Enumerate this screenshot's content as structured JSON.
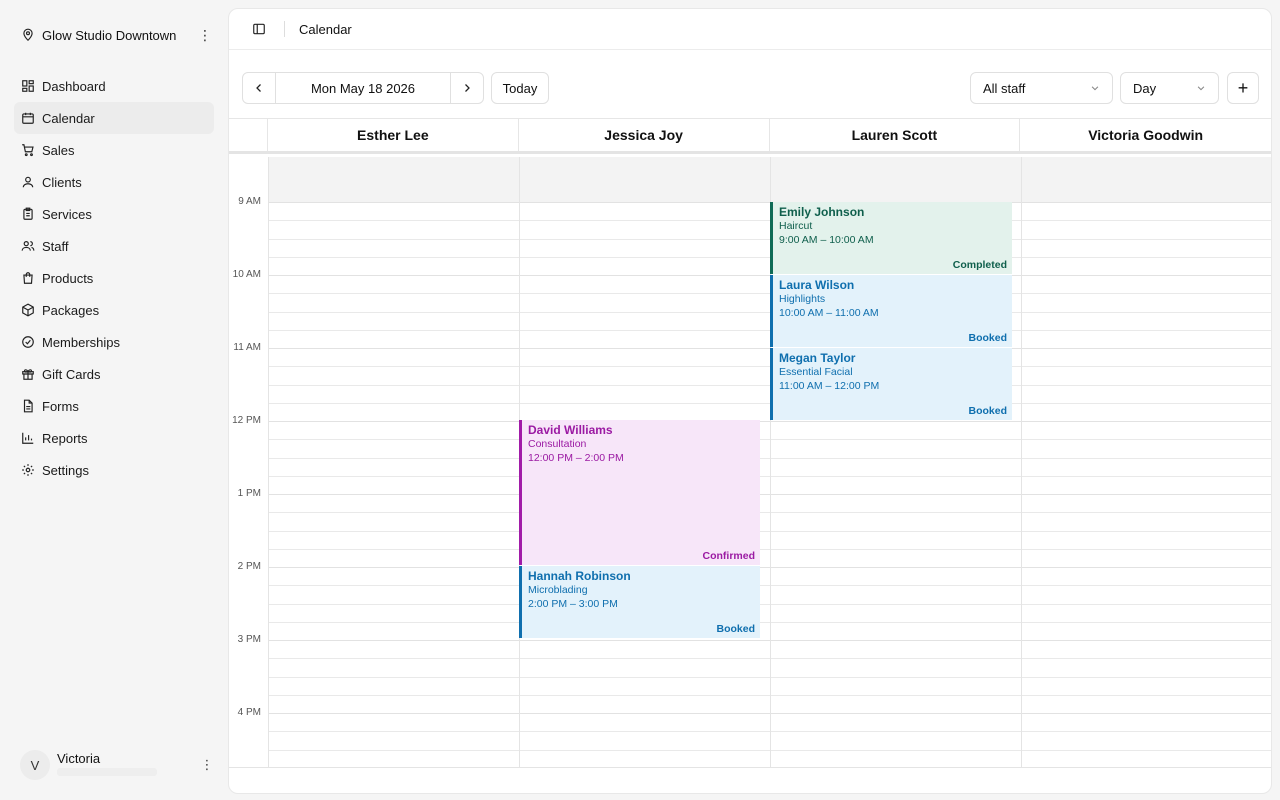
{
  "sidebar": {
    "studio_name": "Glow Studio Downtown",
    "items": [
      {
        "label": "Dashboard",
        "icon": "dashboard-icon"
      },
      {
        "label": "Calendar",
        "icon": "calendar-icon",
        "active": true
      },
      {
        "label": "Sales",
        "icon": "cart-icon"
      },
      {
        "label": "Clients",
        "icon": "user-icon"
      },
      {
        "label": "Services",
        "icon": "clipboard-icon"
      },
      {
        "label": "Staff",
        "icon": "users-icon"
      },
      {
        "label": "Products",
        "icon": "shopping-bag-icon"
      },
      {
        "label": "Packages",
        "icon": "package-icon"
      },
      {
        "label": "Memberships",
        "icon": "badge-check-icon"
      },
      {
        "label": "Gift Cards",
        "icon": "gift-icon"
      },
      {
        "label": "Forms",
        "icon": "document-icon"
      },
      {
        "label": "Reports",
        "icon": "bar-chart-icon"
      },
      {
        "label": "Settings",
        "icon": "gear-icon"
      }
    ],
    "user": {
      "initial": "V",
      "name": "Victoria"
    }
  },
  "header": {
    "breadcrumb": "Calendar"
  },
  "toolbar": {
    "date": "Mon May 18 2026",
    "today_label": "Today",
    "staff_filter": "All staff",
    "view": "Day",
    "add_label": "+"
  },
  "staff": [
    "Esther Lee",
    "Jessica Joy",
    "Lauren Scott",
    "Victoria Goodwin"
  ],
  "hours": [
    "9 AM",
    "10 AM",
    "11 AM",
    "12 PM",
    "1 PM",
    "2 PM",
    "3 PM",
    "4 PM"
  ],
  "appointments": [
    {
      "client": "Emily Johnson",
      "service": "Haircut",
      "time": "9:00 AM – 10:00 AM",
      "status": "Completed"
    },
    {
      "client": "Laura Wilson",
      "service": "Highlights",
      "time": "10:00 AM – 11:00 AM",
      "status": "Booked"
    },
    {
      "client": "Megan Taylor",
      "service": "Essential Facial",
      "time": "11:00 AM – 12:00 PM",
      "status": "Booked"
    },
    {
      "client": "David Williams",
      "service": "Consultation",
      "time": "12:00 PM – 2:00 PM",
      "status": "Confirmed"
    },
    {
      "client": "Hannah Robinson",
      "service": "Microblading",
      "time": "2:00 PM – 3:00 PM",
      "status": "Booked"
    }
  ],
  "colors": {
    "completed": "#0f6b56",
    "booked": "#0f6fae",
    "confirmed": "#a11ca8"
  }
}
